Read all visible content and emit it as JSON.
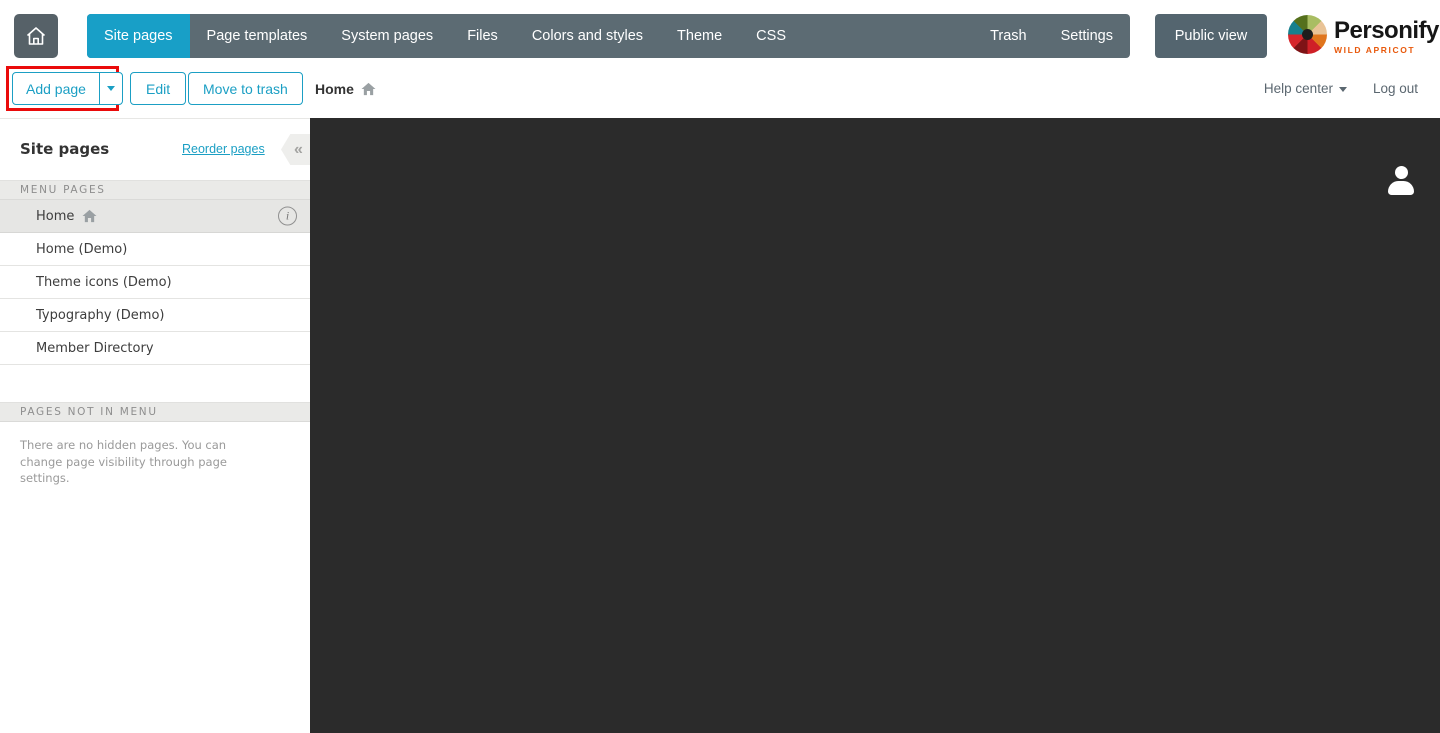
{
  "topnav": {
    "tabs": [
      {
        "label": "Site pages",
        "active": true
      },
      {
        "label": "Page templates",
        "active": false
      },
      {
        "label": "System pages",
        "active": false
      },
      {
        "label": "Files",
        "active": false
      },
      {
        "label": "Colors and styles",
        "active": false
      },
      {
        "label": "Theme",
        "active": false
      },
      {
        "label": "CSS",
        "active": false
      }
    ],
    "right_tabs": [
      {
        "label": "Trash"
      },
      {
        "label": "Settings"
      }
    ],
    "public_view_label": "Public view",
    "brand": {
      "name": "Personify",
      "tagline": "WILD APRICOT"
    }
  },
  "toolbar": {
    "add_page_label": "Add page",
    "edit_label": "Edit",
    "move_to_trash_label": "Move to trash",
    "breadcrumb": "Home",
    "help_center_label": "Help center",
    "log_out_label": "Log out"
  },
  "sidebar": {
    "title": "Site pages",
    "reorder_link": "Reorder pages",
    "menu_section_label": "MENU PAGES",
    "items": [
      {
        "label": "Home",
        "selected": true,
        "has_home_icon": true,
        "has_info": true
      },
      {
        "label": "Home (Demo)"
      },
      {
        "label": "Theme icons (Demo)"
      },
      {
        "label": "Typography (Demo)"
      },
      {
        "label": "Member Directory"
      }
    ],
    "hidden_section_label": "PAGES NOT IN MENU",
    "hidden_note": "There are no hidden pages. You can change page visibility through page settings."
  },
  "icons": {
    "collapse_glyph": "«",
    "info_glyph": "i"
  },
  "colors": {
    "accent_teal": "#1b9fc4",
    "navbar_gray": "#5c6b73",
    "active_tab_teal": "#189fc7",
    "public_view_gray": "#54656f",
    "content_background": "#2b2b2b",
    "annotation_red": "#ea0b0b",
    "brand_orange": "#e8590c",
    "section_bar_gray": "#eaeae8"
  }
}
